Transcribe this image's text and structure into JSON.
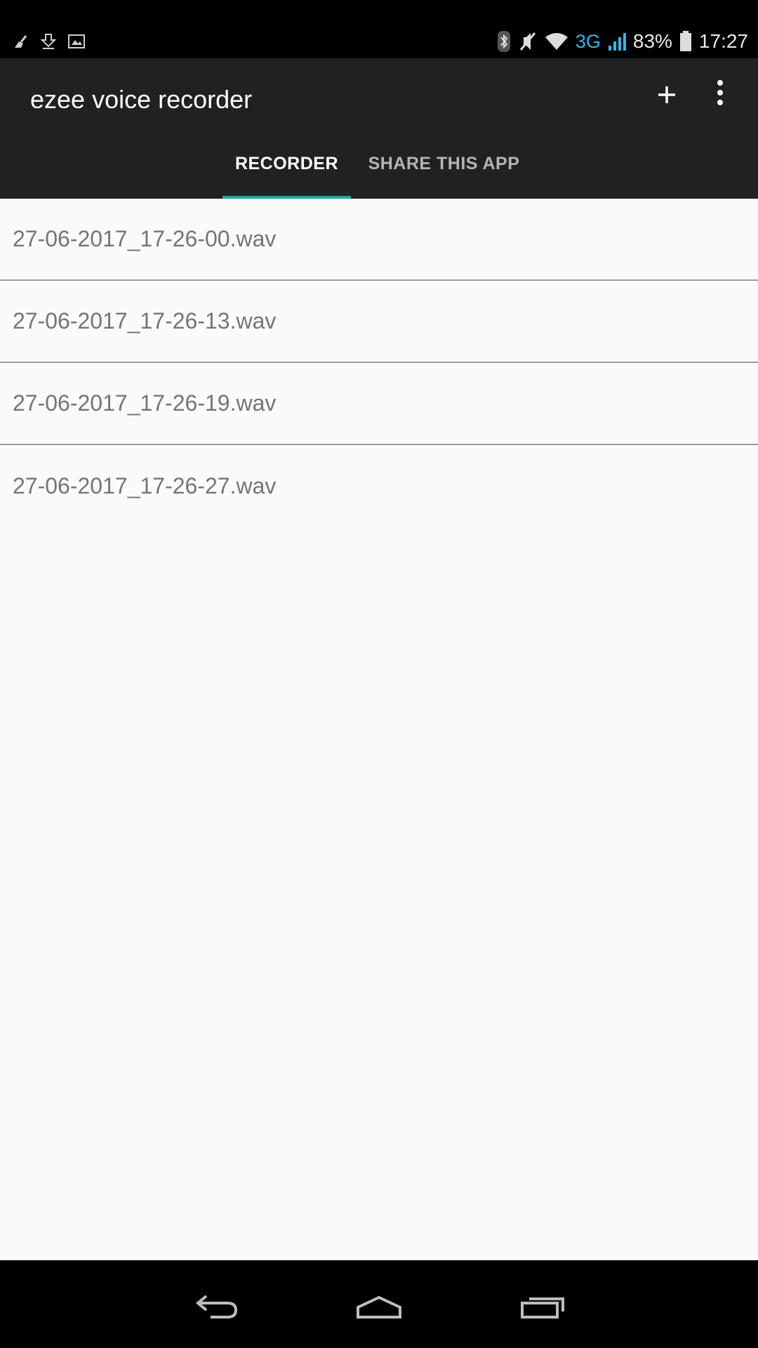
{
  "status_bar": {
    "left_icons": [
      "broom-icon",
      "download-icon",
      "image-icon"
    ],
    "network_type": "3G",
    "battery_percent": "83%",
    "time": "17:27"
  },
  "app_bar": {
    "title": "ezee voice recorder",
    "actions": [
      "add-icon",
      "overflow-menu-icon"
    ]
  },
  "tabs": [
    {
      "label": "RECORDER",
      "selected": true
    },
    {
      "label": "SHARE THIS APP",
      "selected": false
    }
  ],
  "files": [
    {
      "name": "27-06-2017_17-26-00.wav"
    },
    {
      "name": "27-06-2017_17-26-13.wav"
    },
    {
      "name": "27-06-2017_17-26-19.wav"
    },
    {
      "name": "27-06-2017_17-26-27.wav"
    }
  ],
  "nav_bar": [
    "back-icon",
    "home-icon",
    "recents-icon"
  ],
  "colors": {
    "status_bar": "#000000",
    "app_bar": "#212121",
    "tab_indicator": "#26a69a",
    "network_accent": "#33b5e5",
    "list_background": "#fafafa",
    "list_text": "#757575"
  }
}
